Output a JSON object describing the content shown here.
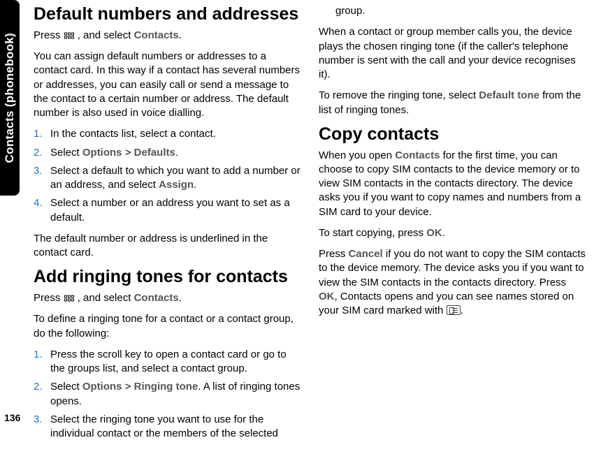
{
  "side_tab": "Contacts (phonebook)",
  "page_number": "136",
  "col1": {
    "h1": "Default numbers and addresses",
    "press_prefix": "Press ",
    "press_suffix": " , and select ",
    "contacts": "Contacts",
    "press_end": ".",
    "para1": "You can assign default numbers or addresses to a contact card. In this way if a contact has several numbers or addresses, you can easily call or send a message to the contact to a certain number or address. The default number is also used in voice dialling.",
    "step1": "In the contacts list, select a contact.",
    "step2a": "Select ",
    "options": "Options",
    "gt": " > ",
    "defaults": "Defaults",
    "step2b": ".",
    "step3a": "Select a default to which you want to add a number or an address, and select ",
    "assign": "Assign",
    "step3b": ".",
    "step4": "Select a number or an address you want to set as a default.",
    "para2": "The default number or address is underlined in the contact card.",
    "h2": "Add ringing tones for contacts",
    "para3": "To define a ringing tone for a contact or a contact group, do the following:"
  },
  "col2": {
    "r1": "Press the scroll key to open a contact card or go to the groups list, and select a contact group.",
    "r2a": "Select ",
    "r2_options": "Options",
    "r2_gt": " > ",
    "r2_ring": "Ringing tone",
    "r2b": ". A list of ringing tones opens.",
    "r3": "Select the ringing tone you want to use for the individual contact or the members of the selected group.",
    "para4": "When a contact or group member calls you, the device plays the chosen ringing tone (if the caller's telephone number is sent with the call and your device recognises it).",
    "para5a": "To remove the ringing tone, select ",
    "default_tone": "Default tone",
    "para5b": " from the list of ringing tones.",
    "h3": "Copy contacts",
    "para6a": "When you open ",
    "para6_contacts": "Contacts",
    "para6b": " for the first time, you can choose to copy SIM contacts to the device memory or to view SIM contacts in the contacts directory. The device asks you if you want to copy names and numbers from a SIM card to your device.",
    "para7a": "To start copying, press ",
    "ok": "OK",
    "para7b": ".",
    "para8a": "Press ",
    "cancel": "Cancel",
    "para8b": " if you do not want to copy the SIM contacts to the device memory. The device asks you if you want to view the SIM contacts in the contacts directory. Press ",
    "para8c": ", Contacts opens and you can see names stored on your SIM card marked with ",
    "para8d": "."
  },
  "nums": {
    "n1": "1.",
    "n2": "2.",
    "n3": "3.",
    "n4": "4."
  }
}
